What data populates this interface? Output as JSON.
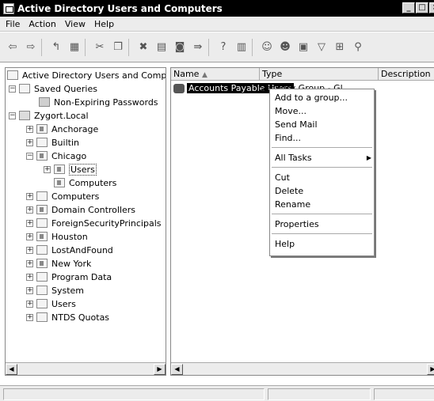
{
  "window": {
    "title": "Active Directory Users and Computers"
  },
  "menubar": {
    "file": "File",
    "action": "Action",
    "view": "View",
    "help": "Help"
  },
  "tree": {
    "root": "Active Directory Users and Comput",
    "saved_queries": "Saved Queries",
    "non_expiring": "Non-Expiring Passwords",
    "domain": "Zygort.Local",
    "anchorage": "Anchorage",
    "builtin": "Builtin",
    "chicago": "Chicago",
    "chicago_users": "Users",
    "chicago_computers": "Computers",
    "computers": "Computers",
    "domain_controllers": "Domain Controllers",
    "foreign": "ForeignSecurityPrincipals",
    "houston": "Houston",
    "lostandfound": "LostAndFound",
    "newyork": "New York",
    "programdata": "Program Data",
    "system": "System",
    "users": "Users",
    "ntds": "NTDS Quotas"
  },
  "list": {
    "col_name": "Name",
    "col_type": "Type",
    "col_desc": "Description",
    "row_name": "Accounts Payable Users",
    "row_type": "Security Group - Gl..."
  },
  "context_menu": {
    "add_group": "Add to a group...",
    "move": "Move...",
    "send_mail": "Send Mail",
    "find": "Find...",
    "all_tasks": "All Tasks",
    "cut": "Cut",
    "delete": "Delete",
    "rename": "Rename",
    "properties": "Properties",
    "help": "Help"
  }
}
